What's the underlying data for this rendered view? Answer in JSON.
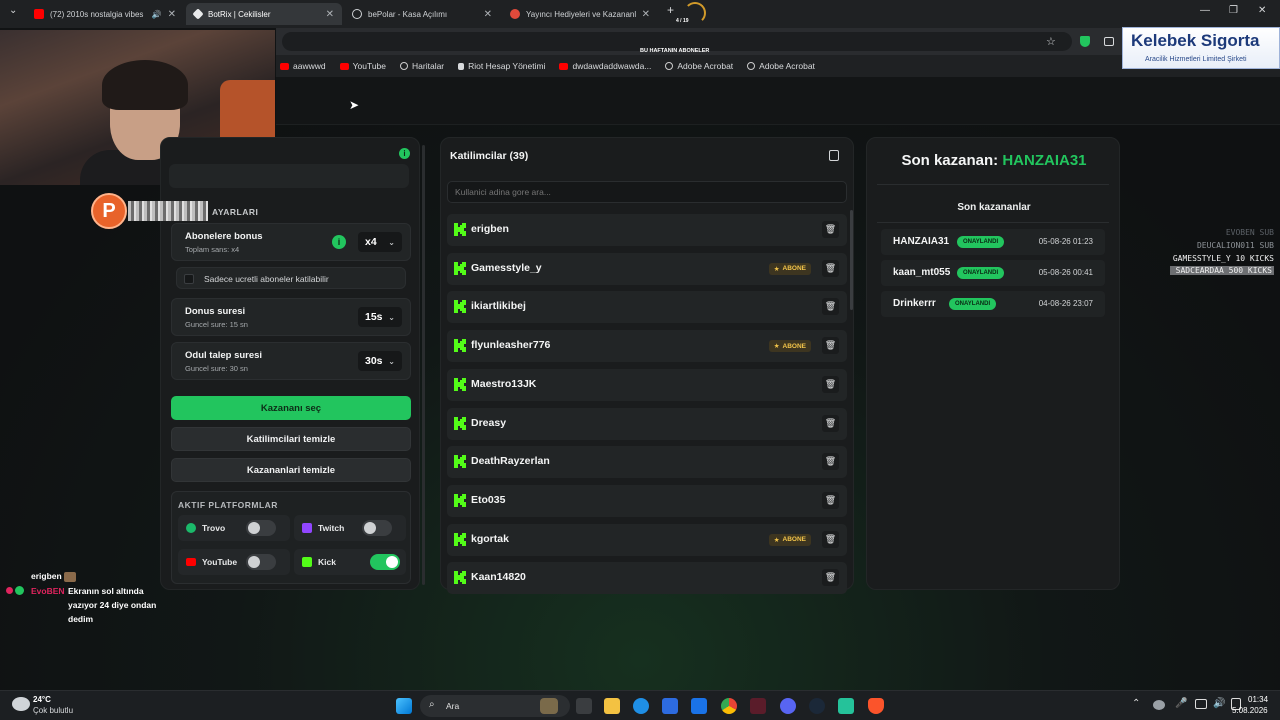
{
  "browser": {
    "tabs": [
      {
        "label": "(72) 2010s nostalgia vibes n",
        "icon": "youtube-icon"
      },
      {
        "label": "BotRix | Cekilisler",
        "icon": "botrix-icon"
      },
      {
        "label": "bePolar - Kasa Açılımı",
        "icon": "globe-icon"
      },
      {
        "label": "Yayıncı Hediyeleri ve Kazananla",
        "icon": "p-icon"
      }
    ],
    "tab_counter": "4 / 19",
    "bookmarks": [
      {
        "label": "aawwwd",
        "icon": "youtube-icon"
      },
      {
        "label": "YouTube",
        "icon": "youtube-icon"
      },
      {
        "label": "Haritalar",
        "icon": "globe-icon"
      },
      {
        "label": "Riot Hesap Yönetimi",
        "icon": "riot-icon"
      },
      {
        "label": "dwdawdaddwawda...",
        "icon": "youtube-icon"
      },
      {
        "label": "Adobe Acrobat",
        "icon": "globe-icon"
      },
      {
        "label": "Adobe Acrobat",
        "icon": "globe-icon"
      }
    ],
    "week_subs_label": "BU HAFTANIN ABONELER"
  },
  "settings": {
    "section_title": "AYARLARI",
    "subscriber_bonus": {
      "label": "Abonelere bonus",
      "sub": "Toplam sans: x4",
      "value": "x4"
    },
    "paid_only": {
      "label": "Sadece ucretli aboneler katilabilir",
      "checked": false
    },
    "bonus_duration": {
      "label": "Donus suresi",
      "sub": "Guncel sure: 15 sn",
      "value": "15s"
    },
    "claim_duration": {
      "label": "Odul talep suresi",
      "sub": "Guncel sure: 30 sn",
      "value": "30s"
    },
    "pick_winner": "Kazananı seç",
    "clear_participants": "Katilimcilari temizle",
    "clear_winners": "Kazananlari temizle",
    "platforms_title": "AKTIF PLATFORMLAR",
    "platforms": [
      {
        "name": "Trovo",
        "enabled": false,
        "color": "#1bb96a"
      },
      {
        "name": "Twitch",
        "enabled": false,
        "color": "#9146ff"
      },
      {
        "name": "YouTube",
        "enabled": false,
        "color": "#ff0000"
      },
      {
        "name": "Kick",
        "enabled": true,
        "color": "#53fc18"
      }
    ]
  },
  "participants": {
    "title": "Katilimcilar (39)",
    "search_placeholder": "Kullanici adina gore ara...",
    "badge_label": "ABONE",
    "list": [
      {
        "name": "erigben",
        "subscriber": false
      },
      {
        "name": "Gamesstyle_y",
        "subscriber": true
      },
      {
        "name": "ikiartlikibej",
        "subscriber": false
      },
      {
        "name": "flyunleasher776",
        "subscriber": true
      },
      {
        "name": "Maestro13JK",
        "subscriber": false
      },
      {
        "name": "Dreasy",
        "subscriber": false
      },
      {
        "name": "DeathRayzerlan",
        "subscriber": false
      },
      {
        "name": "Eto035",
        "subscriber": false
      },
      {
        "name": "kgortak",
        "subscriber": true
      },
      {
        "name": "Kaan14820",
        "subscriber": false
      }
    ]
  },
  "winners": {
    "last_winner_label": "Son kazanan:",
    "last_winner_name": "HANZAIA31",
    "recent_title": "Son kazananlar",
    "status_label": "ONAYLANDI",
    "list": [
      {
        "name": "HANZAIA31",
        "date": "05-08-26 01:23"
      },
      {
        "name": "kaan_mt055",
        "date": "05-08-26 00:41"
      },
      {
        "name": "Drinkerrr",
        "date": "04-08-26 23:07"
      }
    ]
  },
  "overlays": {
    "sponsor_title": "Kelebek Sigorta",
    "sponsor_sub": "Aracilik Hizmetleri Limited Şirketi",
    "sub_feed": [
      "EVOBEN SUB",
      "DEUCALION011 SUB",
      "GAMESSTYLE_Y 10 KICKS",
      "SADCEARDAA 500 KICKS"
    ],
    "chat": {
      "user1": "erigben",
      "user2": "EvoBEN",
      "message": [
        "Ekranın sol altında",
        "yazıyor 24 diye ondan",
        "dedim"
      ]
    }
  },
  "taskbar": {
    "weather_temp": "24°C",
    "weather_desc": "Çok bulutlu",
    "search_label": "Ara",
    "time": "01:34",
    "date": "5.08.2026"
  }
}
